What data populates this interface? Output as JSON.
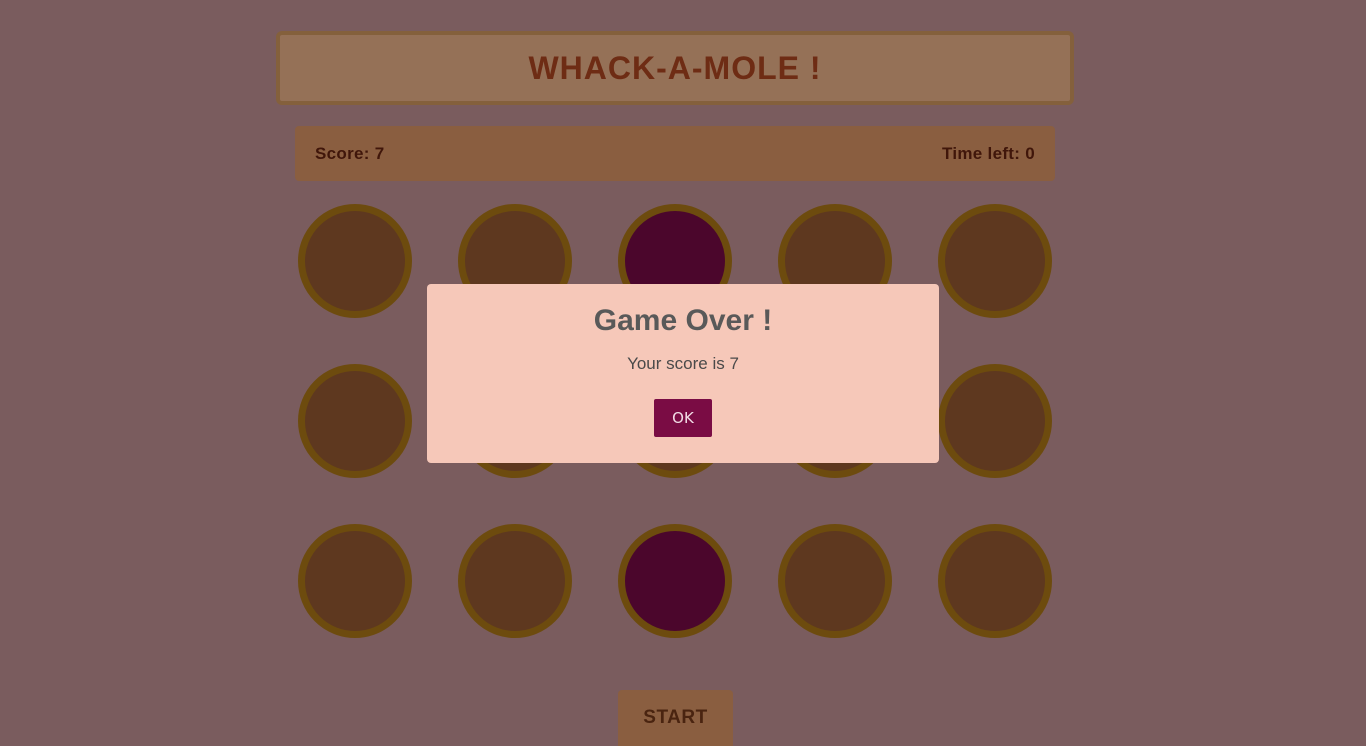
{
  "game": {
    "title": "WHACK-A-MOLE !",
    "score_label": "Score: 7",
    "time_label": "Time left: 0",
    "start_label": "START",
    "grid": {
      "rows": 3,
      "columns": 5,
      "holes": [
        [
          false,
          false,
          true,
          false,
          false
        ],
        [
          false,
          false,
          false,
          false,
          false
        ],
        [
          false,
          false,
          true,
          false,
          false
        ]
      ]
    }
  },
  "dialog": {
    "title": "Game Over !",
    "message": "Your score is 7",
    "ok_label": "OK"
  },
  "colors": {
    "background": "#7a5c5e",
    "hole_rim": "#6d4b0e",
    "hole_empty": "#5e381f",
    "mole": "#4b062c",
    "dialog_bg": "#f6c8b9",
    "ok_button": "#7a0c44"
  }
}
